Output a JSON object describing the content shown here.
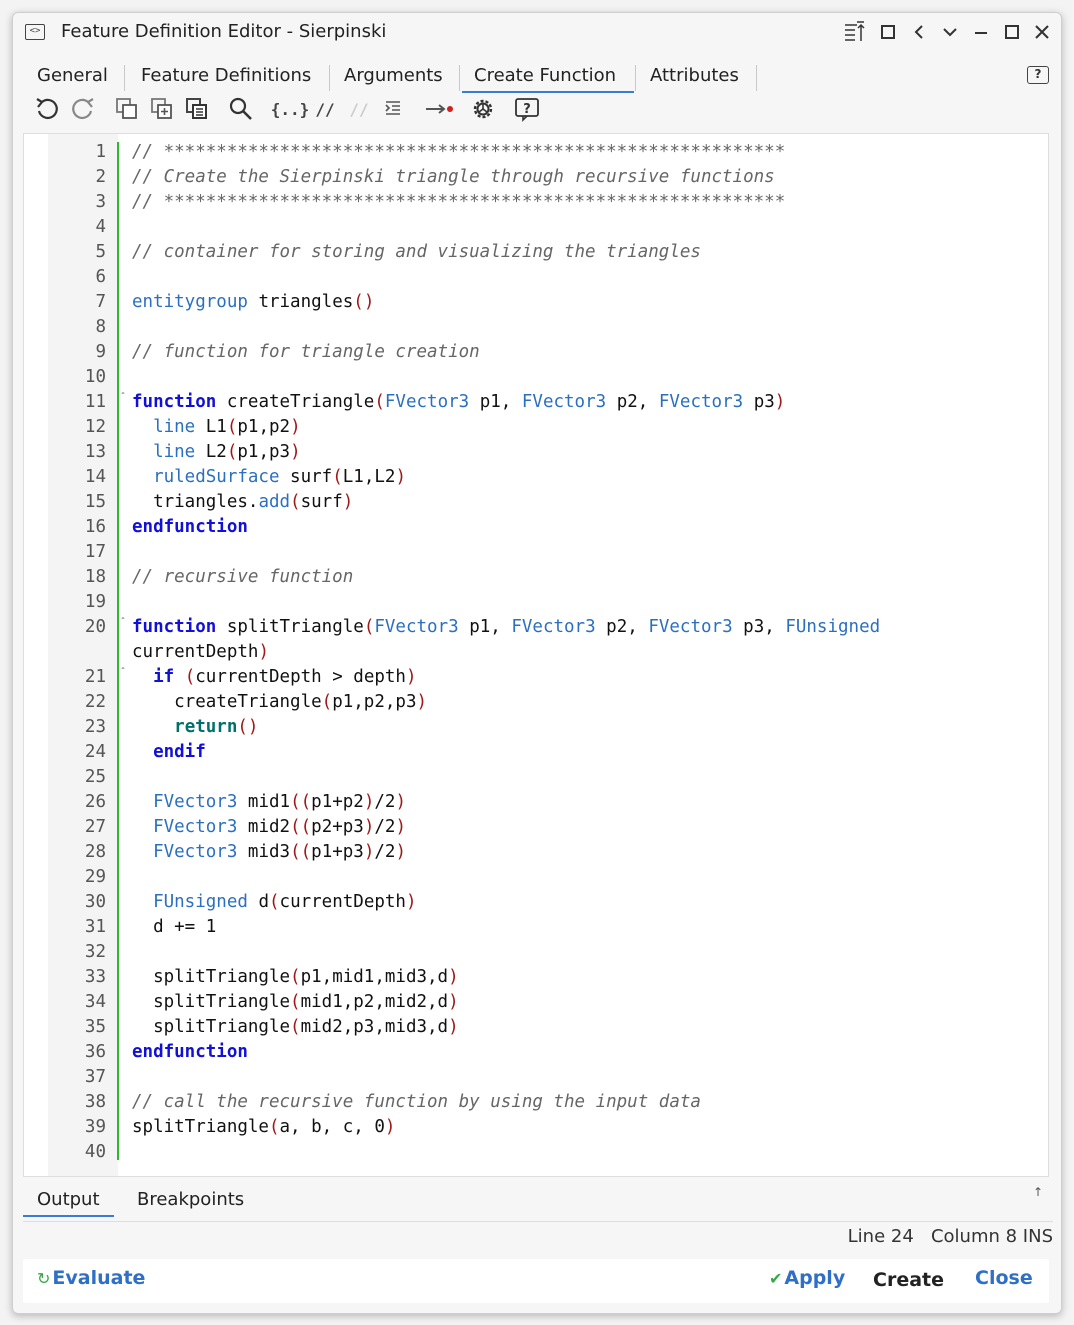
{
  "window": {
    "title": "Feature Definition Editor - Sierpinski",
    "controls": [
      "collapse-icon",
      "maximize-icon",
      "back-icon",
      "chevron-down-icon",
      "minimize-icon",
      "restore-icon",
      "close-icon"
    ]
  },
  "tabs": [
    {
      "label": "General"
    },
    {
      "label": "Feature Definitions"
    },
    {
      "label": "Arguments"
    },
    {
      "label": "Create Function",
      "active": true
    },
    {
      "label": "Attributes"
    }
  ],
  "toolbar": {
    "format_label": "{..}",
    "comment_label": "//",
    "uncomment_label": "//",
    "help_label": "?"
  },
  "code_lines": [
    {
      "n": "1",
      "t": "// ***********************************************************"
    },
    {
      "n": "2",
      "t": "// Create the Sierpinski triangle through recursive functions"
    },
    {
      "n": "3",
      "t": "// ***********************************************************"
    },
    {
      "n": "4",
      "t": ""
    },
    {
      "n": "5",
      "t": "// container for storing and visualizing the triangles"
    },
    {
      "n": "6",
      "t": ""
    },
    {
      "n": "7",
      "t": "entitygroup triangles()"
    },
    {
      "n": "8",
      "t": ""
    },
    {
      "n": "9",
      "t": "// function for triangle creation"
    },
    {
      "n": "10",
      "t": ""
    },
    {
      "n": "11",
      "t": "function createTriangle(FVector3 p1, FVector3 p2, FVector3 p3)"
    },
    {
      "n": "12",
      "t": "  line L1(p1,p2)"
    },
    {
      "n": "13",
      "t": "  line L2(p1,p3)"
    },
    {
      "n": "14",
      "t": "  ruledSurface surf(L1,L2)"
    },
    {
      "n": "15",
      "t": "  triangles.add(surf)"
    },
    {
      "n": "16",
      "t": "endfunction"
    },
    {
      "n": "17",
      "t": ""
    },
    {
      "n": "18",
      "t": "// recursive function"
    },
    {
      "n": "19",
      "t": ""
    },
    {
      "n": "20",
      "t": "function splitTriangle(FVector3 p1, FVector3 p2, FVector3 p3, FUnsigned"
    },
    {
      "n": "",
      "t": "currentDepth)"
    },
    {
      "n": "21",
      "t": "  if (currentDepth > depth)"
    },
    {
      "n": "22",
      "t": "    createTriangle(p1,p2,p3)"
    },
    {
      "n": "23",
      "t": "    return()"
    },
    {
      "n": "24",
      "t": "  endif"
    },
    {
      "n": "25",
      "t": ""
    },
    {
      "n": "26",
      "t": "  FVector3 mid1((p1+p2)/2)"
    },
    {
      "n": "27",
      "t": "  FVector3 mid2((p2+p3)/2)"
    },
    {
      "n": "28",
      "t": "  FVector3 mid3((p1+p3)/2)"
    },
    {
      "n": "29",
      "t": ""
    },
    {
      "n": "30",
      "t": "  FUnsigned d(currentDepth)"
    },
    {
      "n": "31",
      "t": "  d += 1"
    },
    {
      "n": "32",
      "t": ""
    },
    {
      "n": "33",
      "t": "  splitTriangle(p1,mid1,mid3,d)"
    },
    {
      "n": "34",
      "t": "  splitTriangle(mid1,p2,mid2,d)"
    },
    {
      "n": "35",
      "t": "  splitTriangle(mid2,p3,mid3,d)"
    },
    {
      "n": "36",
      "t": "endfunction"
    },
    {
      "n": "37",
      "t": ""
    },
    {
      "n": "38",
      "t": "// call the recursive function by using the input data"
    },
    {
      "n": "39",
      "t": "splitTriangle(a, b, c, 0)"
    },
    {
      "n": "40",
      "t": ""
    }
  ],
  "bottom_tabs": [
    {
      "label": "Output",
      "active": true
    },
    {
      "label": "Breakpoints"
    }
  ],
  "status": {
    "line": "Line 24",
    "column": "Column 8",
    "mode": "INS"
  },
  "buttons": {
    "evaluate": "Evaluate",
    "apply": "Apply",
    "create": "Create",
    "close": "Close"
  },
  "colors": {
    "accent": "#3a7bd5",
    "keyword": "#1010d8",
    "type": "#2b6fc0",
    "comment": "#666666",
    "paren": "#a01818",
    "change_bar": "#2eb82e"
  }
}
